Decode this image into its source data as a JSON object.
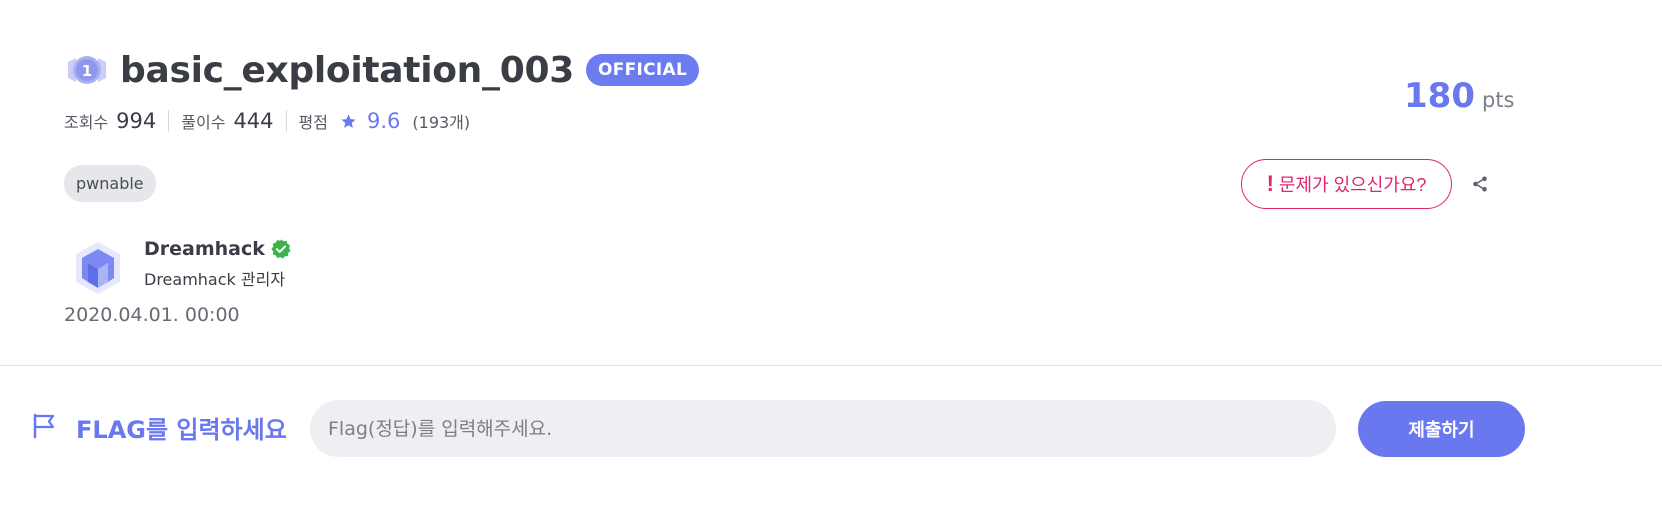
{
  "challenge": {
    "level": "1",
    "title": "basic_exploitation_003",
    "official_badge": "OFFICIAL",
    "stats": {
      "views_label": "조회수",
      "views": "994",
      "solves_label": "풀이수",
      "solves": "444",
      "rating_label": "평점",
      "rating": "9.6",
      "rating_count": "(193개)"
    },
    "tag": "pwnable",
    "points": "180",
    "points_unit": "pts",
    "report_label": "문제가 있으신가요?",
    "report_icon": "!"
  },
  "author": {
    "name": "Dreamhack",
    "role": "Dreamhack 관리자",
    "date": "2020.04.01. 00:00"
  },
  "flag_form": {
    "label": "FLAG를 입력하세요",
    "placeholder": "Flag(정답)를 입력해주세요.",
    "submit_label": "제출하기"
  },
  "colors": {
    "accent": "#6a78f0",
    "report": "#e0246e",
    "verified": "#3bb34a"
  },
  "icons": [
    "level-badge-icon",
    "star-icon",
    "verified-icon",
    "share-icon",
    "flag-icon",
    "dreamhack-logo"
  ]
}
